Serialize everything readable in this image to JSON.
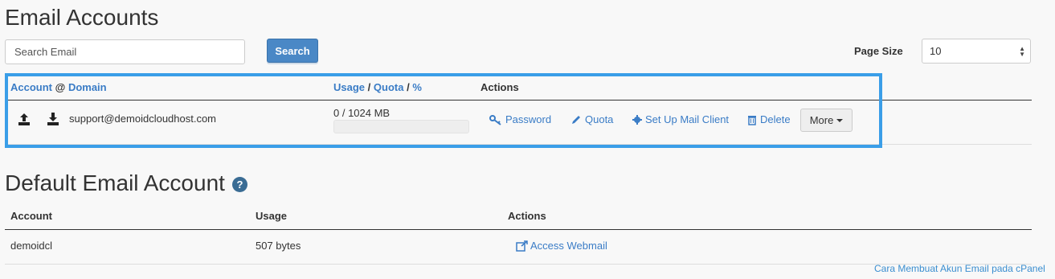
{
  "page": {
    "title": "Email Accounts"
  },
  "search": {
    "placeholder": "Search Email",
    "button_label": "Search"
  },
  "page_size": {
    "label": "Page Size",
    "selected": "10"
  },
  "accounts_table": {
    "headers": {
      "account": "Account",
      "at": "@",
      "domain": "Domain",
      "usage": "Usage",
      "slash1": "/",
      "quota": "Quota",
      "slash2": "/",
      "percent": "%",
      "actions": "Actions"
    },
    "rows": [
      {
        "email": "support@demoidcloudhost.com",
        "usage": "0 / 1024 MB",
        "usage_fraction": 0,
        "actions": {
          "password": "Password",
          "quota": "Quota",
          "setup": "Set Up Mail Client",
          "delete": "Delete",
          "more": "More"
        }
      }
    ]
  },
  "default_account": {
    "title": "Default Email Account",
    "help_icon": "?",
    "headers": {
      "account": "Account",
      "usage": "Usage",
      "actions": "Actions"
    },
    "row": {
      "account": "demoidcl",
      "usage": "507 bytes",
      "action": "Access Webmail"
    }
  },
  "footer": {
    "link": "Cara Membuat Akun Email pada cPanel"
  },
  "colors": {
    "link": "#3a7cc6",
    "primary_button": "#4a88c6",
    "highlight_border": "#3a9ee8"
  }
}
